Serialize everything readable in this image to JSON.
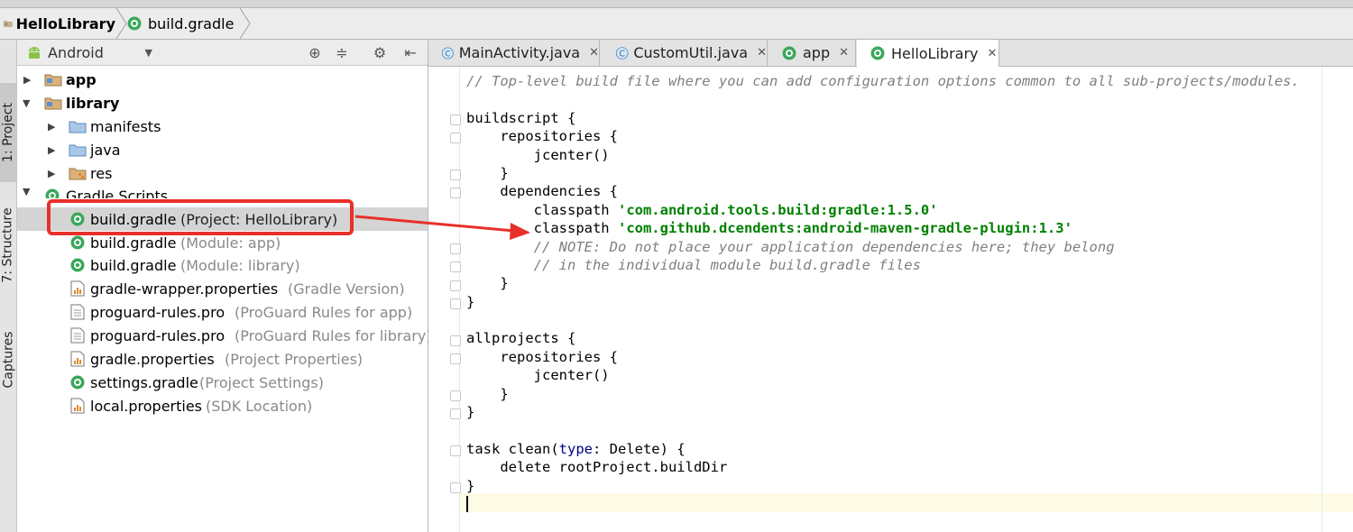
{
  "breadcrumb": {
    "items": [
      {
        "label": "HelloLibrary",
        "icon": "folder-icon"
      },
      {
        "label": "build.gradle",
        "icon": "gradle-icon"
      }
    ]
  },
  "tool_strip": {
    "tabs": [
      {
        "label": "1: Project",
        "active": true
      },
      {
        "label": "7: Structure",
        "active": false
      },
      {
        "label": "Captures",
        "active": false
      }
    ]
  },
  "project_panel": {
    "view_selector": "Android",
    "toolbar_icons": [
      "crosshair-icon",
      "collapse-all-icon",
      "gear-icon",
      "hide-panel-icon"
    ],
    "tree": [
      {
        "label": "app",
        "bold": true,
        "icon": "module-folder-icon",
        "expanded": false
      },
      {
        "label": "library",
        "bold": true,
        "icon": "module-folder-icon",
        "expanded": true
      },
      {
        "label": "manifests",
        "icon": "folder-icon",
        "expanded": false
      },
      {
        "label": "java",
        "icon": "folder-icon",
        "expanded": false
      },
      {
        "label": "res",
        "icon": "res-folder-icon",
        "expanded": false
      },
      {
        "label": "Gradle Scripts",
        "icon": "gradle-icon",
        "expanded": true
      },
      {
        "label": "build.gradle",
        "hint": "(Project: HelloLibrary)",
        "icon": "gradle-icon",
        "selected": true
      },
      {
        "label": "build.gradle",
        "hint": "(Module: app)",
        "icon": "gradle-icon"
      },
      {
        "label": "build.gradle",
        "hint": "(Module: library)",
        "icon": "gradle-icon"
      },
      {
        "label": "gradle-wrapper.properties",
        "hint": "(Gradle Version)",
        "icon": "properties-icon"
      },
      {
        "label": "proguard-rules.pro",
        "hint": "(ProGuard Rules for app)",
        "icon": "text-file-icon"
      },
      {
        "label": "proguard-rules.pro",
        "hint": "(ProGuard Rules for library)",
        "icon": "text-file-icon"
      },
      {
        "label": "gradle.properties",
        "hint": "(Project Properties)",
        "icon": "properties-icon"
      },
      {
        "label": "settings.gradle",
        "hint": "(Project Settings)",
        "icon": "gradle-icon"
      },
      {
        "label": "local.properties",
        "hint": "(SDK Location)",
        "icon": "properties-icon"
      }
    ]
  },
  "editor_tabs": [
    {
      "label": "MainActivity.java",
      "icon": "class-icon",
      "active": false
    },
    {
      "label": "CustomUtil.java",
      "icon": "class-icon",
      "active": false
    },
    {
      "label": "app",
      "icon": "gradle-icon",
      "active": false
    },
    {
      "label": "HelloLibrary",
      "icon": "gradle-icon",
      "active": true
    }
  ],
  "code": {
    "lines": [
      "// Top-level build file where you can add configuration options common to all sub-projects/modules.",
      "",
      "buildscript {",
      "    repositories {",
      "        jcenter()",
      "    }",
      "    dependencies {",
      "        classpath 'com.android.tools.build:gradle:1.5.0'",
      "        classpath 'com.github.dcendents:android-maven-gradle-plugin:1.3'",
      "        // NOTE: Do not place your application dependencies here; they belong",
      "        // in the individual module build.gradle files",
      "    }",
      "}",
      "",
      "allprojects {",
      "    repositories {",
      "        jcenter()",
      "    }",
      "}",
      "",
      "task clean(type: Delete) {",
      "    delete rootProject.buildDir",
      "}",
      ""
    ]
  },
  "colors": {
    "annotation": "#e8302a",
    "string": "#008000",
    "comment": "#808080",
    "gradle_green": "#3aa85b"
  }
}
